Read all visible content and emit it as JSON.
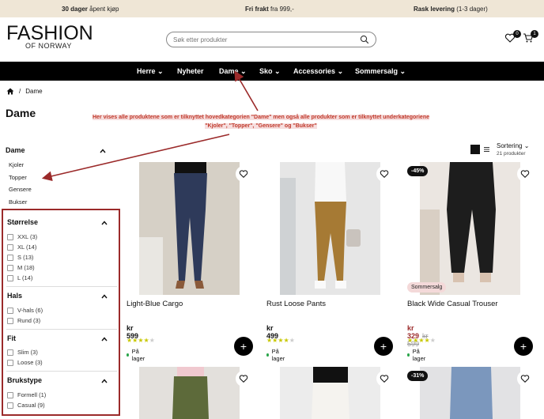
{
  "topbar": {
    "m1_bold": "30 dager",
    "m1_rest": " åpent kjøp",
    "m2_bold": "Fri frakt",
    "m2_rest": " fra 999,-",
    "m3_bold": "Rask levering",
    "m3_rest": " (1-3 dager)"
  },
  "header": {
    "logo_main": "FASHION",
    "logo_sub": "OF NORWAY",
    "search_placeholder": "Søk etter produkter",
    "wishlist_count": "0",
    "cart_count": "1"
  },
  "nav": [
    "Herre",
    "Nyheter",
    "Dame",
    "Sko",
    "Accessories",
    "Sommersalg"
  ],
  "breadcrumb": {
    "current": "Dame"
  },
  "page_title": "Dame",
  "annotation": {
    "line1": "Her vises alle produktene som er tilknyttet hovedkategorien \"Dame\" men også alle produkter som er tilknyttet underkategoriene",
    "line2": "\"Kjoler\", \"Topper\", \"Gensere\" og \"Bukser\""
  },
  "sort": {
    "label": "Sortering",
    "count": "21 produkter"
  },
  "sidebar": {
    "section": "Dame",
    "links": [
      "Kjoler",
      "Topper",
      "Gensere",
      "Bukser"
    ]
  },
  "filters": [
    {
      "title": "Størrelse",
      "options": [
        "XXL (3)",
        "XL (14)",
        "S (13)",
        "M (18)",
        "L (14)"
      ]
    },
    {
      "title": "Hals",
      "options": [
        "V-hals (6)",
        "Rund (3)"
      ]
    },
    {
      "title": "Fit",
      "options": [
        "Slim (3)",
        "Loose (3)"
      ]
    },
    {
      "title": "Brukstype",
      "options": [
        "Formell (1)",
        "Casual (9)"
      ]
    }
  ],
  "products": [
    {
      "name": "Light-Blue Cargo",
      "price": "kr 599",
      "old_price": "",
      "discount": "",
      "badge": "",
      "stock": "På lager",
      "rating": 4
    },
    {
      "name": "Rust Loose Pants",
      "price": "kr 499",
      "old_price": "",
      "discount": "",
      "badge": "",
      "stock": "På lager",
      "rating": 4
    },
    {
      "name": "Black Wide Casual Trouser",
      "price": "kr 329",
      "old_price": "kr 599",
      "discount": "-45%",
      "badge": "Sommersalg",
      "stock": "På lager",
      "rating": 4
    }
  ],
  "row2": {
    "discount": "-31%"
  },
  "colors": {
    "accent": "#9b2a2a",
    "annot": "#c0392b",
    "nav_bg": "#000000",
    "topbar_bg": "#efe6d6",
    "star": "#c8c800",
    "stock": "#2aa54a"
  }
}
